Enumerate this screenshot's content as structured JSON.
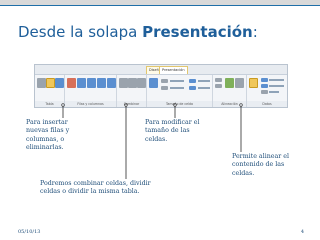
{
  "slide": {
    "title_prefix": "Desde la solapa ",
    "title_emphasis": "Presentación",
    "title_suffix": ":"
  },
  "ribbon": {
    "context_tabs": [
      "Diseño",
      "Presentación"
    ],
    "groups": [
      {
        "label": "Tabla",
        "buttons": [
          "Seleccionar",
          "Ver cuadrícula",
          "Propiedades"
        ]
      },
      {
        "label": "Filas y columnas",
        "buttons": [
          "Eliminar",
          "Insertar arriba",
          "Insertar debajo",
          "Insertar a la izquierda",
          "Insertar a la derecha"
        ]
      },
      {
        "label": "Combinar",
        "buttons": [
          "Combinar celdas",
          "Dividir celdas",
          "Dividir tabla"
        ]
      },
      {
        "label": "Tamaño de celda",
        "buttons": [
          "Autoajustar",
          "Alto",
          "Ancho",
          "Distribuir filas",
          "Distribuir columnas"
        ]
      },
      {
        "label": "Alineación",
        "buttons": [
          "Dirección del texto",
          "Márgenes de celda"
        ]
      },
      {
        "label": "Datos",
        "buttons": [
          "Ordenar",
          "Repetir filas de título",
          "Convertir texto a",
          "Fórmula"
        ]
      }
    ]
  },
  "annotations": {
    "insert": "Para insertar\nnuevas filas y\ncolumnas, o\neliminarlas.",
    "resize": "Para modificar el\ntamaño de las\nceldas.",
    "align": "Permite alinear el\ncontenido de las\nceldas.",
    "merge": "Podremos combinar celdas, dividir\nceldas o dividir la misma tabla."
  },
  "footer": {
    "date": "05/10/13",
    "page_number": "4"
  },
  "colors": {
    "title": "#1f5f9a",
    "annotation_text": "#1f4e79",
    "callout_line": "#2b2b2b",
    "accent_stripe": "#1f6fa8"
  }
}
